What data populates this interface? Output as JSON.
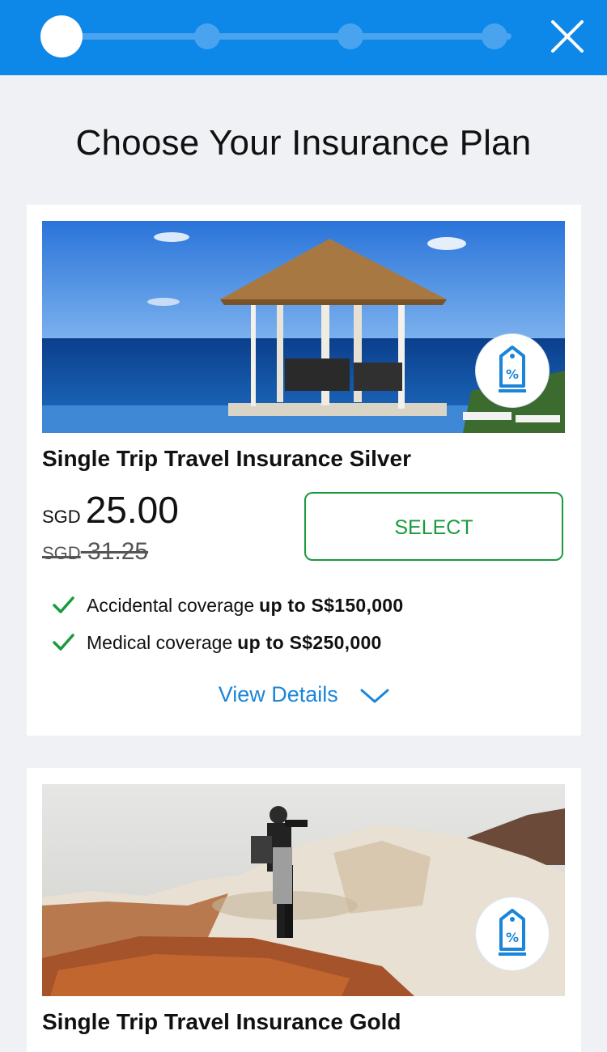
{
  "progress": {
    "steps": 4,
    "current_step": 1
  },
  "header": {
    "close_icon": "close-icon"
  },
  "page": {
    "title": "Choose Your Insurance Plan"
  },
  "plans": [
    {
      "name": "Single Trip Travel Insurance Silver",
      "currency": "SGD",
      "price": "25.00",
      "old_currency": "SGD",
      "old_price": "31.25",
      "select_label": "SELECT",
      "features": [
        {
          "text": "Accidental coverage",
          "highlight": "up to S$150,000"
        },
        {
          "text": "Medical coverage",
          "highlight": "up to S$250,000"
        }
      ],
      "details_label": "View Details",
      "badge_icon": "discount-tag-icon",
      "image": "gazebo-by-the-sea"
    },
    {
      "name": "Single Trip Travel Insurance Gold",
      "badge_icon": "discount-tag-icon",
      "image": "hiker-on-canyon-rocks"
    }
  ],
  "colors": {
    "header": "#0d87e8",
    "accent_green": "#1a9a3c",
    "link_blue": "#1b86d9",
    "background": "#f0f1f4"
  }
}
